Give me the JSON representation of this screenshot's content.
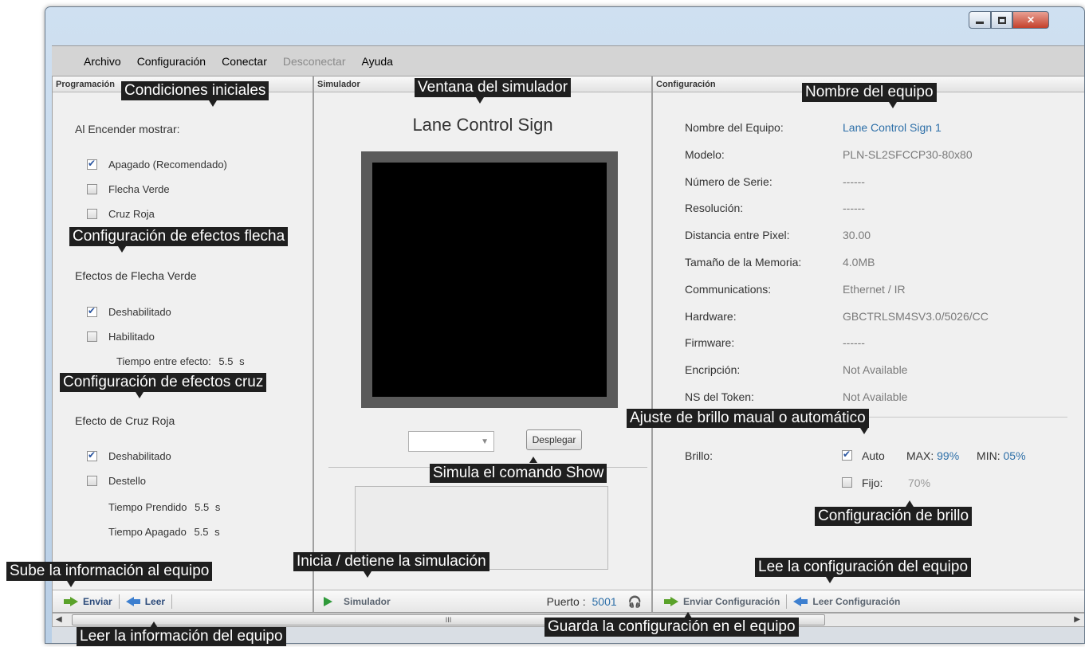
{
  "menu": [
    "Archivo",
    "Configuración",
    "Conectar",
    "Desconectar",
    "Ayuda"
  ],
  "panels": {
    "programacion": "Programación",
    "simulador": "Simulador",
    "configuracion": "Configuración"
  },
  "left": {
    "al_encender": "Al Encender mostrar:",
    "opt_apagado": "Apagado (Recomendado)",
    "opt_flecha": "Flecha Verde",
    "opt_cruz": "Cruz Roja",
    "efectos_flecha": "Efectos de Flecha Verde",
    "flecha_deshab": "Deshabilitado",
    "flecha_hab": "Habilitado",
    "tiempo_efecto_label": "Tiempo entre efecto:",
    "tiempo_efecto_val": "5.5",
    "unit_s": "s",
    "efecto_cruz": "Efecto de Cruz Roja",
    "cruz_deshab": "Deshabilitado",
    "cruz_destello": "Destello",
    "tiempo_prendido_label": "Tiempo Prendido",
    "tiempo_prendido_val": "5.5",
    "tiempo_apagado_label": "Tiempo Apagado",
    "tiempo_apagado_val": "5.5",
    "foot_enviar": "Enviar",
    "foot_leer": "Leer"
  },
  "mid": {
    "title": "Lane Control Sign",
    "desplegar": "Desplegar",
    "foot_sim": "Simulador",
    "puerto_label": "Puerto :",
    "puerto_val": "5001"
  },
  "right": {
    "rows": [
      {
        "label": "Nombre del Equipo:",
        "value": "Lane Control Sign 1"
      },
      {
        "label": "Modelo:",
        "value": "PLN-SL2SFCCP30-80x80"
      },
      {
        "label": "Número de Serie:",
        "value": "------"
      },
      {
        "label": "Resolución:",
        "value": "------"
      },
      {
        "label": "Distancia entre Pixel:",
        "value": "30.00"
      },
      {
        "label": "Tamaño de la Memoria:",
        "value": "4.0MB"
      },
      {
        "label": "Communications:",
        "value": "Ethernet / IR"
      },
      {
        "label": "Hardware:",
        "value": "GBCTRLSM4SV3.0/5026/CC"
      },
      {
        "label": "Firmware:",
        "value": "------"
      },
      {
        "label": "Encripción:",
        "value": "Not Available"
      },
      {
        "label": "NS del Token:",
        "value": "Not Available"
      }
    ],
    "brillo": "Brillo:",
    "auto": "Auto",
    "max_label": "MAX:",
    "max_val": "99%",
    "min_label": "MIN:",
    "min_val": "05%",
    "fijo": "Fijo:",
    "fijo_val": "70%",
    "foot_enviar": "Enviar Configuración",
    "foot_leer": "Leer Configuración"
  },
  "scroll_glyph": "III",
  "annotations": {
    "condiciones": "Condiciones iniciales",
    "ventana": "Ventana del simulador",
    "nombre": "Nombre del equipo",
    "efectos_flecha": "Configuración de efectos flecha",
    "efectos_cruz": "Configuración de efectos cruz",
    "brillo_auto": "Ajuste de brillo maual o automático",
    "show": "Simula el comando Show",
    "config_brillo": "Configuración de brillo",
    "sube": "Sube la información al equipo",
    "inicia": "Inicia / detiene la simulación",
    "lee": "Lee la configuración del equipo",
    "leer_info": "Leer la información del equipo",
    "guarda": "Guarda la configuración en el equipo"
  }
}
